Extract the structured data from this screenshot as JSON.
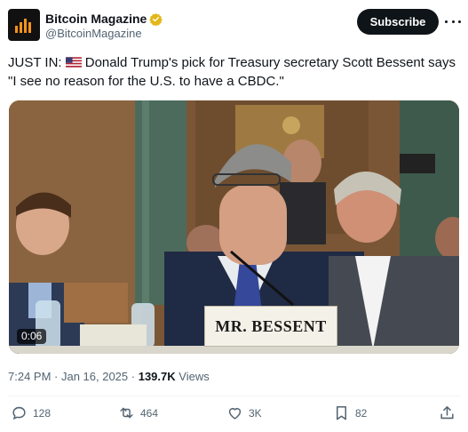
{
  "account": {
    "name": "Bitcoin Magazine",
    "handle": "@BitcoinMagazine",
    "subscribe_label": "Subscribe"
  },
  "tweet": {
    "prefix": "JUST IN:",
    "flag_icon": "us-flag-icon",
    "text": "Donald Trump's pick for Treasury secretary Scott Bessent says \"I see no reason for the U.S. to have a CBDC.\""
  },
  "media": {
    "timer": "0:06",
    "nameplate": "MR. BESSENT"
  },
  "meta": {
    "timestamp": "7:24 PM · Jan 16, 2025 ·",
    "views_count": "139.7K",
    "views_label": "Views"
  },
  "actions": {
    "replies": "128",
    "reposts": "464",
    "likes": "3K",
    "bookmarks": "82"
  },
  "colors": {
    "brand_orange": "#f7931a",
    "verified_gold": "#e2b719",
    "text_primary": "#0f1419",
    "text_secondary": "#536471"
  }
}
